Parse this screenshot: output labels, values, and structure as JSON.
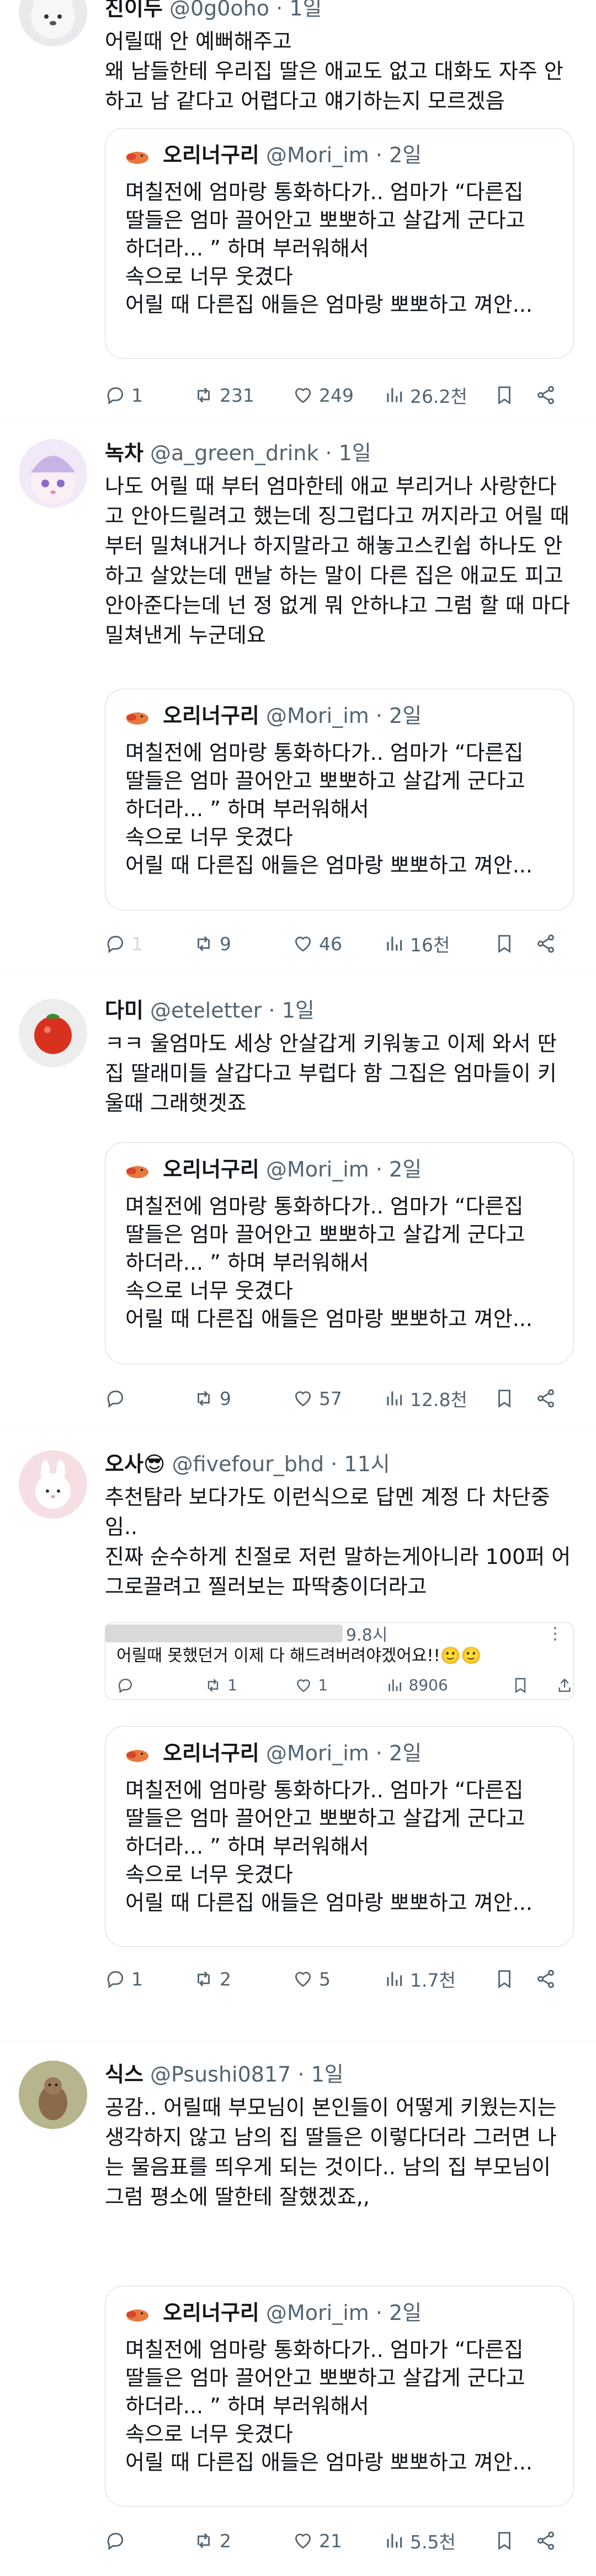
{
  "tweets": [
    {
      "name": "진이두",
      "handle": "@0g0oho",
      "time": "1일",
      "body": "어릴때 안 예뻐해주고\n왜 남들한테 우리집 딸은 애교도 없고 대화도 자주 안하고 남 같다고 어렵다고 얘기하는지 모르겠음",
      "quote": {
        "name": "오리너구리",
        "handle": "@Mori_im",
        "time": "2일",
        "lines": [
          "며칠전에 엄마랑 통화하다가.. 엄마가 “다른집",
          "딸들은 엄마 끌어안고 뽀뽀하고 살갑게 군다고",
          "하더라... ” 하며 부러워해서",
          "속으로 너무 웃겼다",
          "어릴 때 다른집 애들은 엄마랑 뽀뽀하고 껴안..."
        ]
      },
      "stats": {
        "replies": "1",
        "retweets": "231",
        "likes": "249",
        "views": "26.2천"
      }
    },
    {
      "name": "녹차",
      "handle": "@a_green_drink",
      "time": "1일",
      "body": "나도 어릴 때 부터 엄마한테 애교 부리거나 사랑한다고 안아드릴려고 했는데 징그럽다고 꺼지라고 어릴 때 부터 밀쳐내거나 하지말라고 해놓고스킨쉽 하나도 안하고 살았는데 맨날 하는 말이 다른 집은 애교도 피고 안아준다는데 넌 정 없게 뭐 안하냐고 그럼 할 때 마다 밀쳐낸게 누군데요",
      "quote": {
        "name": "오리너구리",
        "handle": "@Mori_im",
        "time": "2일",
        "lines": [
          "며칠전에 엄마랑 통화하다가.. 엄마가 “다른집",
          "딸들은 엄마 끌어안고 뽀뽀하고 살갑게 군다고",
          "하더라... ” 하며 부러워해서",
          "속으로 너무 웃겼다",
          "어릴 때 다른집 애들은 엄마랑 뽀뽀하고 껴안..."
        ]
      },
      "stats": {
        "replies": "1",
        "retweets": "9",
        "likes": "46",
        "views": "16천"
      }
    },
    {
      "name": "다미",
      "handle": "@eteletter",
      "time": "1일",
      "body": "ㅋㅋ 울엄마도 세상 안살갑게 키워놓고 이제 와서 딴집 딸래미들 살갑다고 부럽다 함 그집은 엄마들이 키울때 그래햇겟죠",
      "quote": {
        "name": "오리너구리",
        "handle": "@Mori_im",
        "time": "2일",
        "lines": [
          "며칠전에 엄마랑 통화하다가.. 엄마가 “다른집",
          "딸들은 엄마 끌어안고 뽀뽀하고 살갑게 군다고",
          "하더라... ” 하며 부러워해서",
          "속으로 너무 웃겼다",
          "어릴 때 다른집 애들은 엄마랑 뽀뽀하고 껴안..."
        ]
      },
      "stats": {
        "replies": "",
        "retweets": "9",
        "likes": "57",
        "views": "12.8천"
      }
    },
    {
      "name": "오사😎",
      "handle": "@fivefour_bhd",
      "time": "11시",
      "body": "추천탐라 보다가도 이런식으로 답멘 계정 다 차단중임..\n진짜 순수하게 친절로 저런 말하는게아니라 100퍼 어그로끌려고 찔러보는 파딱충이더라고",
      "nested": {
        "time": "9.8시",
        "text": "어릴때 못했던거 이제 다 해드려버려야겠어요!!🙂🙂",
        "replies": "",
        "retweets": "1",
        "likes": "1",
        "views": "8906"
      },
      "quote": {
        "name": "오리너구리",
        "handle": "@Mori_im",
        "time": "2일",
        "lines": [
          "며칠전에 엄마랑 통화하다가.. 엄마가 “다른집",
          "딸들은 엄마 끌어안고 뽀뽀하고 살갑게 군다고",
          "하더라... ” 하며 부러워해서",
          "속으로 너무 웃겼다",
          "어릴 때 다른집 애들은 엄마랑 뽀뽀하고 껴안..."
        ]
      },
      "stats": {
        "replies": "1",
        "retweets": "2",
        "likes": "5",
        "views": "1.7천"
      }
    },
    {
      "name": "식스",
      "handle": "@Psushi0817",
      "time": "1일",
      "body": "공감.. 어릴때 부모님이 본인들이 어떻게 키웠는지는 생각하지 않고 남의 집 딸들은 이렇다더라 그러면 나는 물음표를 띄우게 되는 것이다.. 남의 집 부모님이 그럼 평소에 딸한테 잘했겠죠,,",
      "quote": {
        "name": "오리너구리",
        "handle": "@Mori_im",
        "time": "2일",
        "lines": [
          "며칠전에 엄마랑 통화하다가.. 엄마가 “다른집",
          "딸들은 엄마 끌어안고 뽀뽀하고 살갑게 군다고",
          "하더라... ” 하며 부러워해서",
          "속으로 너무 웃겼다",
          "어릴 때 다른집 애들은 엄마랑 뽀뽀하고 껴안..."
        ]
      },
      "stats": {
        "replies": "",
        "retweets": "2",
        "likes": "21",
        "views": "5.5천"
      }
    }
  ],
  "colors": {
    "secondary": "#536471",
    "border": "#cfd9de",
    "divider": "#eff3f4"
  }
}
